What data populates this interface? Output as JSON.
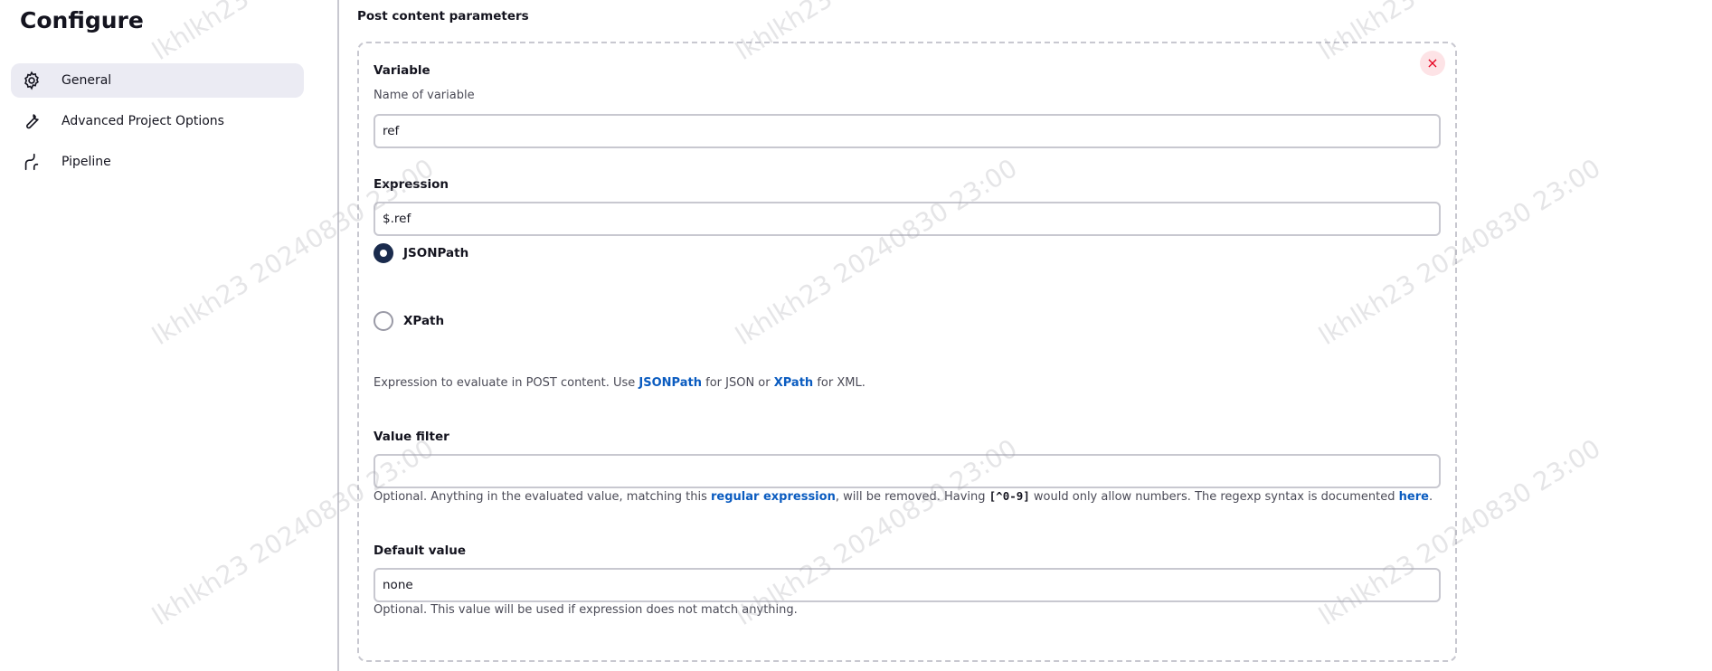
{
  "sidebar": {
    "title": "Configure",
    "items": [
      {
        "label": "General",
        "icon": "gear-icon",
        "active": true
      },
      {
        "label": "Advanced Project Options",
        "icon": "wrench-icon",
        "active": false
      },
      {
        "label": "Pipeline",
        "icon": "pipeline-icon",
        "active": false
      }
    ]
  },
  "main": {
    "section_title": "Post content parameters",
    "close_label": "×",
    "variable": {
      "label": "Variable",
      "description": "Name of variable",
      "value": "ref"
    },
    "expression": {
      "label": "Expression",
      "value": "$.ref",
      "options": [
        {
          "label": "JSONPath",
          "checked": true
        },
        {
          "label": "XPath",
          "checked": false
        }
      ],
      "help_prefix": "Expression to evaluate in POST content. Use ",
      "help_link1": "JSONPath",
      "help_mid": " for JSON or ",
      "help_link2": "XPath",
      "help_suffix": " for XML."
    },
    "value_filter": {
      "label": "Value filter",
      "value": "",
      "help_prefix": "Optional. Anything in the evaluated value, matching this ",
      "help_link": "regular expression",
      "help_mid": ", will be removed. Having ",
      "help_code": "[^0-9]",
      "help_mid2": " would only allow numbers. The regexp syntax is documented ",
      "help_link2": "here",
      "help_suffix": "."
    },
    "default_value": {
      "label": "Default value",
      "value": "none",
      "help": "Optional. This value will be used if expression does not match anything."
    }
  },
  "watermark": "lkhlkh23 20240830 23:00",
  "colors": {
    "accent": "#1a2b4d",
    "link": "#0b5cc0",
    "close": "#e6001f"
  }
}
